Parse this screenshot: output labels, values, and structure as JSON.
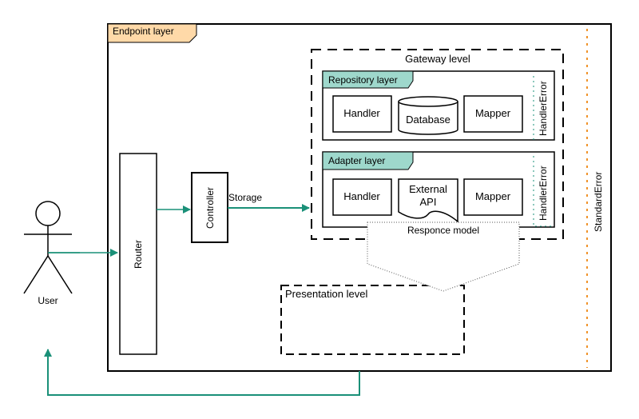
{
  "diagram": {
    "endpoint_layer": {
      "label": "Endpoint layer",
      "tab_color": "#ffd9a8"
    },
    "gateway_level": {
      "label": "Gateway level"
    },
    "repository_layer": {
      "label": "Repository layer",
      "tab_color": "#9ed8cc",
      "components": [
        "Handler",
        "Database",
        "Mapper"
      ],
      "error_label": "HandlerError"
    },
    "adapter_layer": {
      "label": "Adapter layer",
      "tab_color": "#9ed8cc",
      "components": [
        "Handler",
        "External API",
        "Mapper"
      ],
      "external_api_lines": [
        "External",
        "API"
      ],
      "error_label": "HandlerError"
    },
    "router": {
      "label": "Router"
    },
    "controller": {
      "label": "Controller"
    },
    "storage_edge": {
      "label": "Storage"
    },
    "response_model": {
      "label": "Responce model"
    },
    "presentation_level": {
      "label": "Presentation level"
    },
    "user": {
      "label": "User"
    },
    "standard_error": {
      "label": "StandardError",
      "color": "#f0932a"
    },
    "edge_color": "#1a9078",
    "handler_error_color": "#1a9078"
  }
}
